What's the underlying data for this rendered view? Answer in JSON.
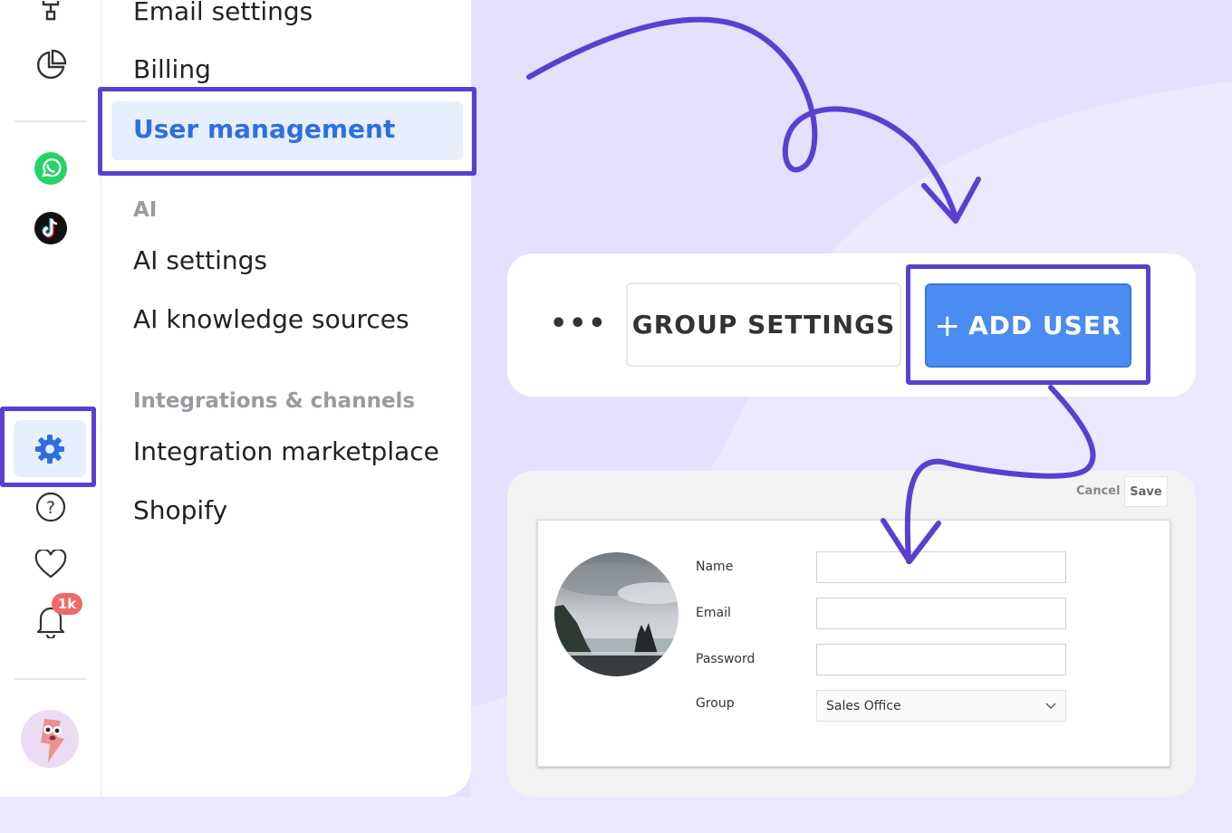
{
  "colors": {
    "highlight_frame": "#5b3fd0",
    "active_item_bg": "#e7effd",
    "active_item_text": "#2e6fe0",
    "primary_button": "#4a8cf0",
    "badge": "#f06a6a"
  },
  "rail": {
    "icons": [
      "flowchart-icon",
      "pie-chart-icon",
      "whatsapp-icon",
      "tiktok-icon",
      "settings-gear-icon",
      "help-icon",
      "heart-icon",
      "bell-icon"
    ],
    "notification_badge": "1k"
  },
  "menu": {
    "items_top": [
      "Email settings",
      "Billing"
    ],
    "active_item": "User management",
    "section_ai": "AI",
    "ai_items": [
      "AI settings",
      "AI knowledge sources"
    ],
    "section_integrations": "Integrations & channels",
    "integration_items": [
      "Integration marketplace",
      "Shopify"
    ]
  },
  "toolbar": {
    "more": "•••",
    "group_settings": "GROUP SETTINGS",
    "add_user_plus": "+",
    "add_user": "ADD USER"
  },
  "form": {
    "cancel": "Cancel",
    "save": "Save",
    "fields": [
      {
        "label": "Name",
        "value": ""
      },
      {
        "label": "Email",
        "value": ""
      },
      {
        "label": "Password",
        "value": ""
      }
    ],
    "group_label": "Group",
    "group_value": "Sales Office"
  }
}
